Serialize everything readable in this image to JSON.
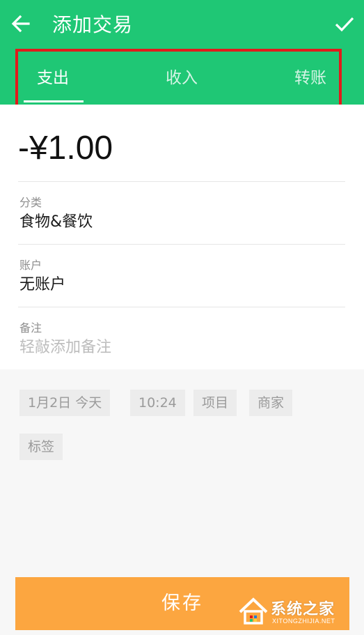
{
  "header": {
    "title": "添加交易",
    "back_icon": "arrow-left-icon",
    "confirm_icon": "check-icon",
    "color": "#1fc775"
  },
  "tabs": [
    {
      "label": "支出",
      "active": true
    },
    {
      "label": "收入",
      "active": false
    },
    {
      "label": "转账",
      "active": false
    }
  ],
  "highlight_color": "#e01b1b",
  "amount": "-¥1.00",
  "fields": {
    "category": {
      "label": "分类",
      "value": "食物&餐饮"
    },
    "account": {
      "label": "账户",
      "value": "无账户"
    },
    "note": {
      "label": "备注",
      "placeholder": "轻敲添加备注"
    }
  },
  "chips": {
    "date": "1月2日  今天",
    "time": "10:24",
    "project": "项目",
    "merchant": "商家",
    "tag": "标签"
  },
  "save_button": {
    "label": "保存",
    "color": "#fca640"
  },
  "watermark": {
    "text": "系统之家",
    "sub": "XITONGZHIJIA.NET"
  }
}
